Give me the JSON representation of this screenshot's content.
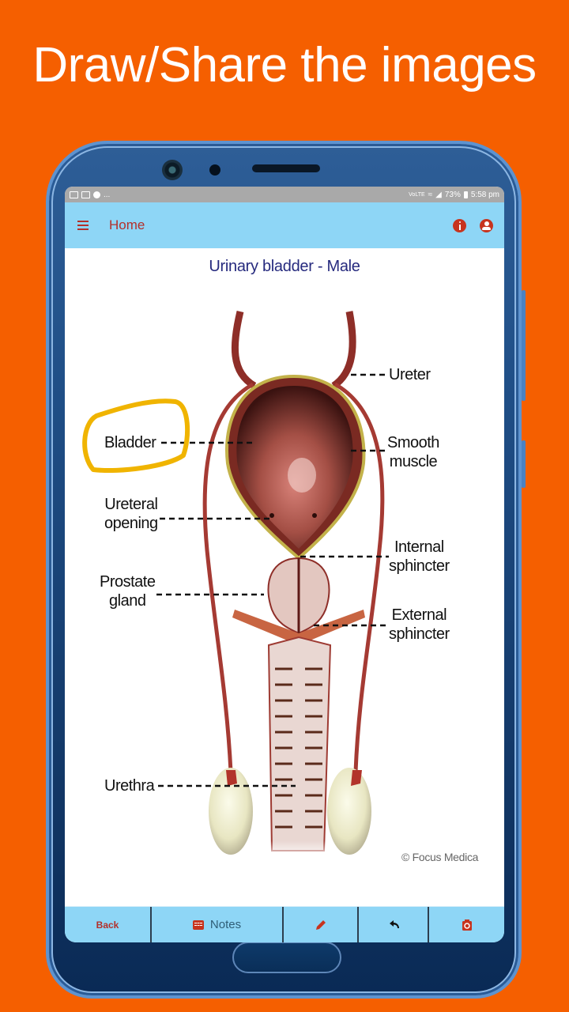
{
  "promo": {
    "title": "Draw/Share the images"
  },
  "status_bar": {
    "left_icons": [
      "mail-icon",
      "gmail-icon",
      "app-icon",
      "more-notifications"
    ],
    "more": "...",
    "network": "VoLTE",
    "battery": "73%",
    "time": "5:58 pm"
  },
  "app_bar": {
    "menu_icon": "hamburger-menu-icon",
    "title": "Home",
    "actions": [
      "info-icon",
      "account-icon"
    ]
  },
  "content": {
    "title": "Urinary bladder - Male",
    "diagram": {
      "labels": {
        "ureter": "Ureter",
        "bladder": "Bladder",
        "smooth_muscle_1": "Smooth",
        "smooth_muscle_2": "muscle",
        "ureteral_opening_1": "Ureteral",
        "ureteral_opening_2": "opening",
        "internal_sphincter_1": "Internal",
        "internal_sphincter_2": "sphincter",
        "prostate_gland_1": "Prostate",
        "prostate_gland_2": "gland",
        "external_sphincter_1": "External",
        "external_sphincter_2": "sphincter",
        "urethra": "Urethra"
      },
      "highlight": {
        "label": "Bladder",
        "color": "#F0B400"
      },
      "copyright": "© Focus Medica"
    }
  },
  "bottom_bar": {
    "back": "Back",
    "notes": "Notes",
    "draw_icon": "pencil-icon",
    "undo_icon": "undo-icon",
    "camera_icon": "camera-icon"
  },
  "colors": {
    "background": "#F55F00",
    "app_bar": "#8ED6F6",
    "accent": "#B3302A",
    "title": "#262A7E"
  }
}
